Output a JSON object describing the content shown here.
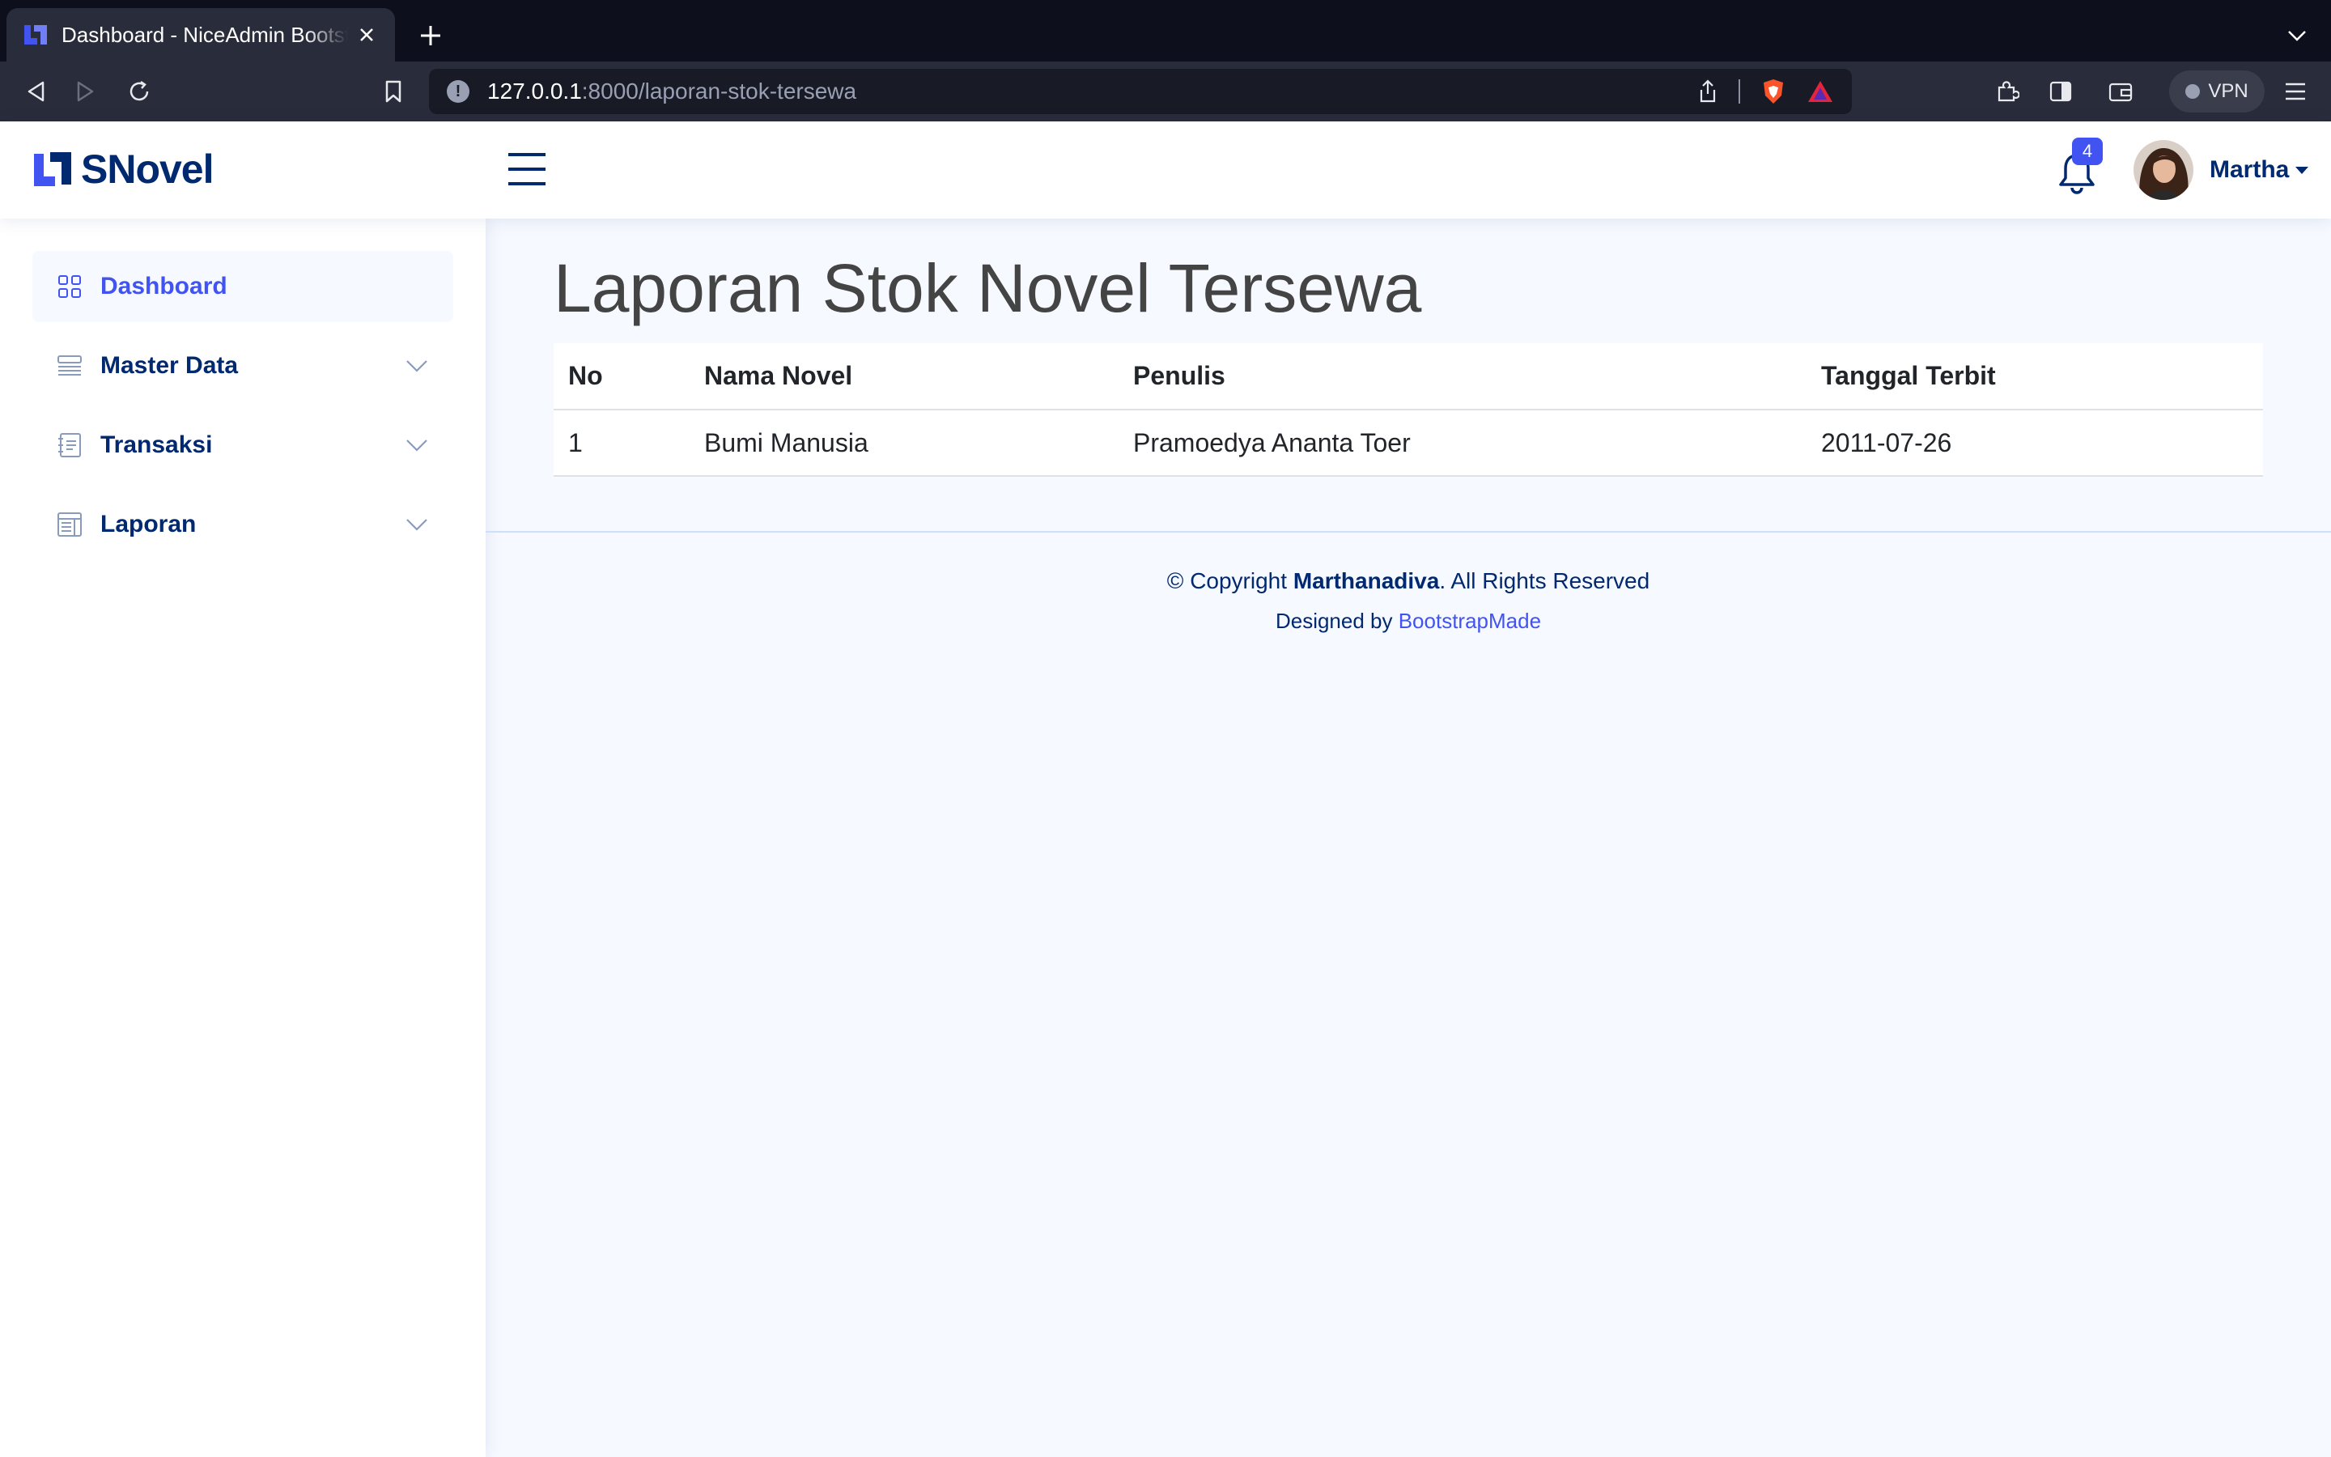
{
  "browser": {
    "tab_title": "Dashboard - NiceAdmin Bootstrap Template",
    "url_host": "127.0.0.1",
    "url_path": ":8000/laporan-stok-tersewa",
    "vpn_label": "VPN"
  },
  "header": {
    "logo_text": "SNovel",
    "notification_count": "4",
    "user_name": "Martha"
  },
  "sidebar": {
    "items": [
      {
        "label": "Dashboard",
        "icon": "grid-icon",
        "active": true
      },
      {
        "label": "Master Data",
        "icon": "menu-button-icon",
        "expandable": true
      },
      {
        "label": "Transaksi",
        "icon": "journal-text-icon",
        "expandable": true
      },
      {
        "label": "Laporan",
        "icon": "layout-text-window-icon",
        "expandable": true
      }
    ]
  },
  "main": {
    "title": "Laporan Stok Novel Tersewa",
    "table": {
      "headers": [
        "No",
        "Nama Novel",
        "Penulis",
        "Tanggal Terbit"
      ],
      "rows": [
        [
          "1",
          "Bumi Manusia",
          "Pramoedya Ananta Toer",
          "2011-07-26"
        ]
      ]
    }
  },
  "footer": {
    "copyright_prefix": "© Copyright ",
    "copyright_owner": "Marthanadiva",
    "copyright_suffix": ". All Rights Reserved",
    "designed_by": "Designed by ",
    "designer": "BootstrapMade"
  },
  "colors": {
    "primary": "#4154f1",
    "brand_dark": "#012970",
    "background": "#f6f9ff"
  }
}
